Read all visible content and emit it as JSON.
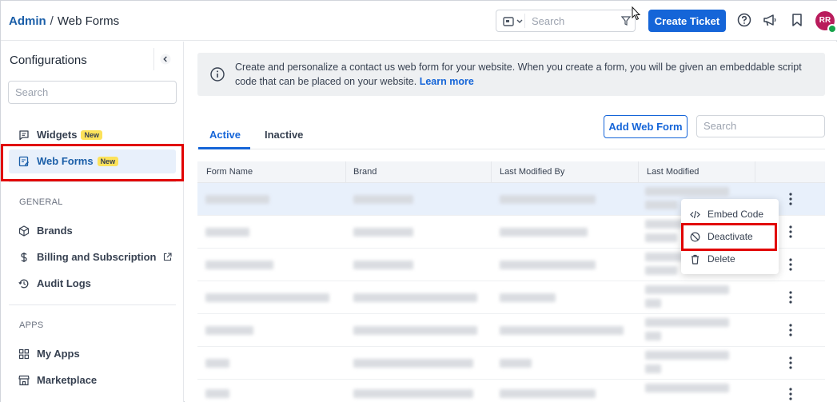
{
  "header": {
    "breadcrumb_root": "Admin",
    "breadcrumb_sep": "/",
    "breadcrumb_current": "Web Forms",
    "search_placeholder": "Search",
    "create_ticket_label": "Create Ticket",
    "avatar_initials": "RR",
    "icons": [
      "scope-icon",
      "filter-icon",
      "help-icon",
      "megaphone-icon",
      "bookmark-icon"
    ]
  },
  "sidebar": {
    "title": "Configurations",
    "search_placeholder": "Search",
    "items": [
      {
        "label": "Widgets",
        "badge": "New",
        "icon": "message-icon"
      },
      {
        "label": "Web Forms",
        "badge": "New",
        "icon": "form-icon",
        "active": true
      }
    ],
    "general_label": "GENERAL",
    "general_items": [
      {
        "label": "Brands",
        "icon": "cube-icon"
      },
      {
        "label": "Billing and Subscription",
        "icon": "dollar-icon"
      },
      {
        "label": "Audit Logs",
        "icon": "history-icon"
      }
    ],
    "apps_label": "APPS",
    "apps_items": [
      {
        "label": "My Apps",
        "icon": "grid-icon"
      },
      {
        "label": "Marketplace",
        "icon": "store-icon"
      }
    ]
  },
  "main": {
    "info_text": "Create and personalize a contact us web form for your website. When you create a form, you will be given an embeddable script code that can be placed on your website.",
    "info_link": "Learn more",
    "tabs": [
      {
        "label": "Active",
        "active": true
      },
      {
        "label": "Inactive",
        "active": false
      }
    ],
    "add_button_label": "Add Web Form",
    "search_placeholder": "Search",
    "table": {
      "columns": [
        "Form Name",
        "Brand",
        "Last Modified By",
        "Last Modified"
      ]
    },
    "row_menu": {
      "items": [
        {
          "label": "Embed Code",
          "icon": "code-icon"
        },
        {
          "label": "Deactivate",
          "icon": "ban-icon"
        },
        {
          "label": "Delete",
          "icon": "trash-icon"
        }
      ]
    }
  },
  "colors": {
    "primary": "#1565d8",
    "highlight": "#e10000",
    "badge": "#fce25a",
    "avatar": "#b91c5c"
  }
}
